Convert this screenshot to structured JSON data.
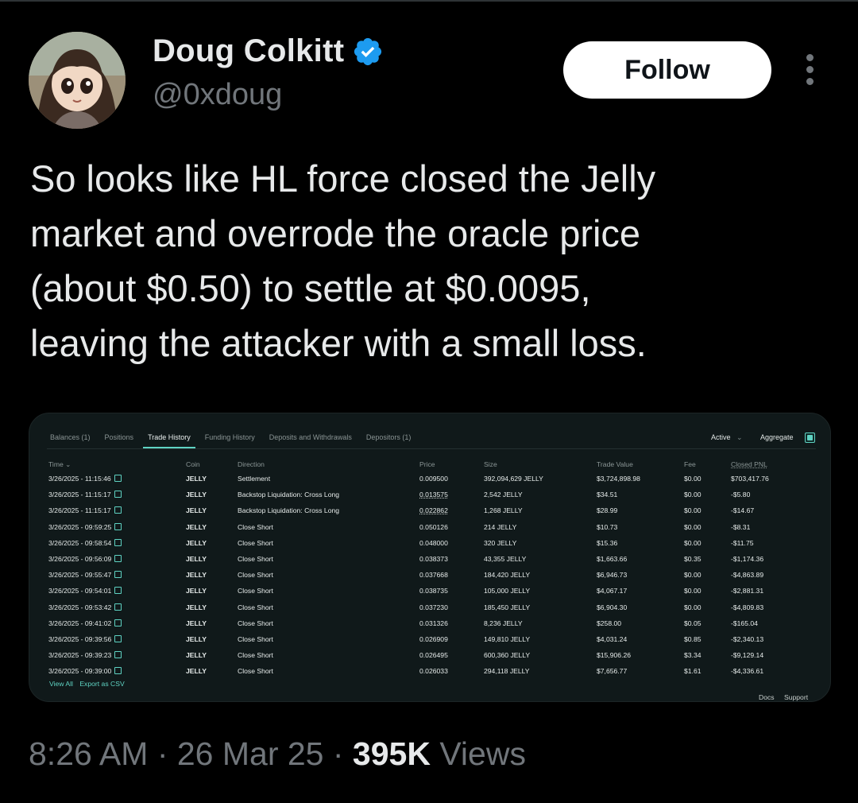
{
  "author": {
    "name": "Doug Colkitt",
    "handle": "@0xdoug",
    "verified_color": "#1d9bf0"
  },
  "follow_label": "Follow",
  "tweet_text": "So looks like HL force closed the Jelly\nmarket and overrode the oracle price\n(about $0.50) to settle at $0.0095,\nleaving the attacker with a small loss.",
  "meta": {
    "time": "8:26 AM",
    "sep1": " · ",
    "date": "26 Mar 25",
    "sep2": " · ",
    "views_count": "395K",
    "views_label": " Views"
  },
  "media": {
    "tabs": [
      "Balances (1)",
      "Positions",
      "Trade History",
      "Funding History",
      "Deposits and Withdrawals",
      "Depositors (1)"
    ],
    "active_tab": "Trade History",
    "filter_label": "Active",
    "aggregate_label": "Aggregate",
    "columns": [
      "Time ⌄",
      "Coin",
      "Direction",
      "Price",
      "Size",
      "Trade Value",
      "Fee",
      "Closed PNL"
    ],
    "rows": [
      [
        "3/26/2025 - 11:15:46",
        "JELLY",
        "Settlement",
        "0.009500",
        "392,094,629 JELLY",
        "$3,724,898.98",
        "$0.00",
        "$703,417.76"
      ],
      [
        "3/26/2025 - 11:15:17",
        "JELLY",
        "Backstop Liquidation: Cross Long",
        "0.013575",
        "2,542 JELLY",
        "$34.51",
        "$0.00",
        "-$5.80"
      ],
      [
        "3/26/2025 - 11:15:17",
        "JELLY",
        "Backstop Liquidation: Cross Long",
        "0.022862",
        "1,268 JELLY",
        "$28.99",
        "$0.00",
        "-$14.67"
      ],
      [
        "3/26/2025 - 09:59:25",
        "JELLY",
        "Close Short",
        "0.050126",
        "214 JELLY",
        "$10.73",
        "$0.00",
        "-$8.31"
      ],
      [
        "3/26/2025 - 09:58:54",
        "JELLY",
        "Close Short",
        "0.048000",
        "320 JELLY",
        "$15.36",
        "$0.00",
        "-$11.75"
      ],
      [
        "3/26/2025 - 09:56:09",
        "JELLY",
        "Close Short",
        "0.038373",
        "43,355 JELLY",
        "$1,663.66",
        "$0.35",
        "-$1,174.36"
      ],
      [
        "3/26/2025 - 09:55:47",
        "JELLY",
        "Close Short",
        "0.037668",
        "184,420 JELLY",
        "$6,946.73",
        "$0.00",
        "-$4,863.89"
      ],
      [
        "3/26/2025 - 09:54:01",
        "JELLY",
        "Close Short",
        "0.038735",
        "105,000 JELLY",
        "$4,067.17",
        "$0.00",
        "-$2,881.31"
      ],
      [
        "3/26/2025 - 09:53:42",
        "JELLY",
        "Close Short",
        "0.037230",
        "185,450 JELLY",
        "$6,904.30",
        "$0.00",
        "-$4,809.83"
      ],
      [
        "3/26/2025 - 09:41:02",
        "JELLY",
        "Close Short",
        "0.031326",
        "8,236 JELLY",
        "$258.00",
        "$0.05",
        "-$165.04"
      ],
      [
        "3/26/2025 - 09:39:56",
        "JELLY",
        "Close Short",
        "0.026909",
        "149,810 JELLY",
        "$4,031.24",
        "$0.85",
        "-$2,340.13"
      ],
      [
        "3/26/2025 - 09:39:23",
        "JELLY",
        "Close Short",
        "0.026495",
        "600,360 JELLY",
        "$15,906.26",
        "$3.34",
        "-$9,129.14"
      ],
      [
        "3/26/2025 - 09:39:00",
        "JELLY",
        "Close Short",
        "0.026033",
        "294,118 JELLY",
        "$7,656.77",
        "$1.61",
        "-$4,336.61"
      ]
    ],
    "view_all": "View All",
    "export_csv": "Export as CSV",
    "docs": "Docs",
    "support": "Support",
    "accent_color": "#5fd3c3"
  }
}
